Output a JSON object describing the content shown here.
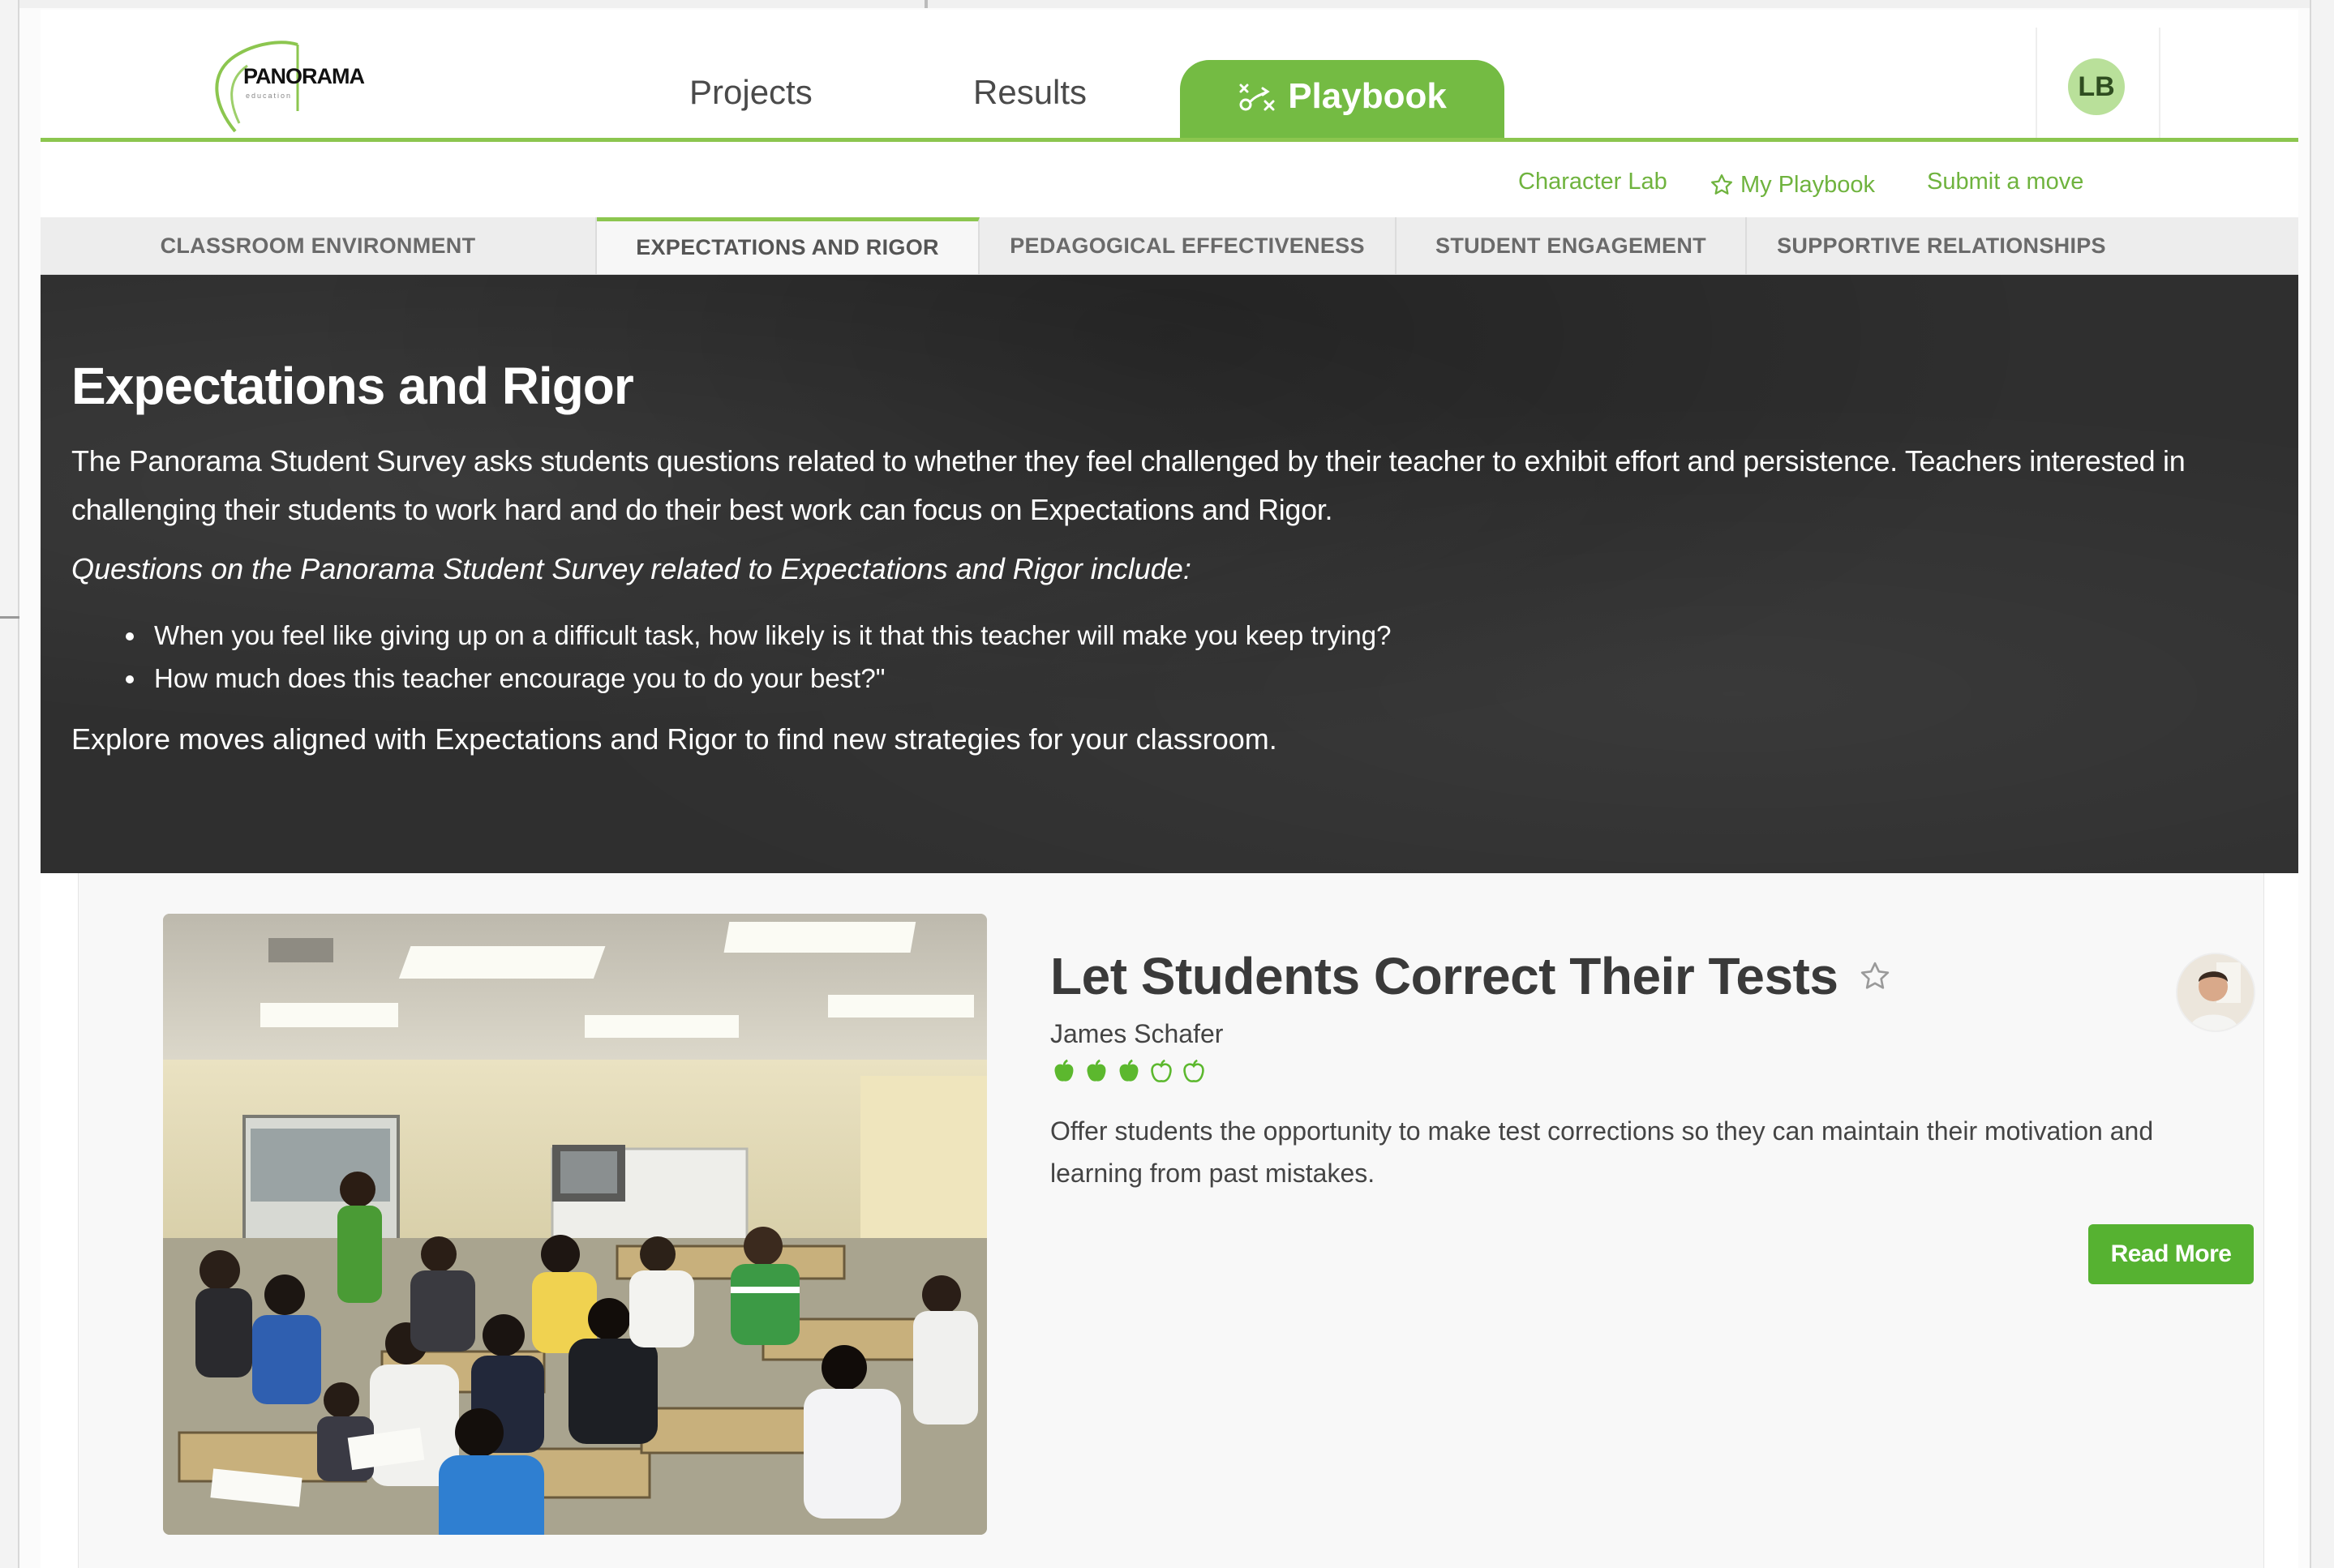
{
  "header": {
    "logo": {
      "word": "PANORAMA",
      "sub": "education"
    },
    "nav": {
      "projects": "Projects",
      "results": "Results",
      "playbook": "Playbook"
    },
    "user_initials": "LB",
    "active_nav": "playbook",
    "accent_color": "#74bb43"
  },
  "sublinks": {
    "character_lab": "Character Lab",
    "my_playbook": "My Playbook",
    "submit_move": "Submit a move"
  },
  "categories": [
    {
      "label": "CLASSROOM ENVIRONMENT",
      "active": false
    },
    {
      "label": "EXPECTATIONS AND RIGOR",
      "active": true
    },
    {
      "label": "PEDAGOGICAL EFFECTIVENESS",
      "active": false
    },
    {
      "label": "STUDENT ENGAGEMENT",
      "active": false
    },
    {
      "label": "SUPPORTIVE RELATIONSHIPS",
      "active": false
    }
  ],
  "hero": {
    "title": "Expectations and Rigor",
    "intro": "The Panorama Student Survey asks students questions related to whether they feel challenged by their teacher to exhibit effort and persistence. Teachers interested in challenging their students to work hard and do their best work can focus on Expectations and Rigor.",
    "questions_lead": "Questions on the Panorama Student Survey related to Expectations and Rigor include:",
    "questions": [
      "When you feel like giving up on a difficult task, how likely is it that this teacher will make you keep trying?",
      "How much does this teacher encourage you to do your best?\""
    ],
    "outro": "Explore moves aligned with Expectations and Rigor to find new strategies for your classroom."
  },
  "move": {
    "title": "Let Students Correct Their Tests",
    "author": "James Schafer",
    "rating": {
      "filled": 3,
      "total": 5
    },
    "description": "Offer students the opportunity to make test corrections so they can maintain their motivation and learning from past mistakes.",
    "read_more": "Read More",
    "rating_color": "#5cb82e"
  }
}
